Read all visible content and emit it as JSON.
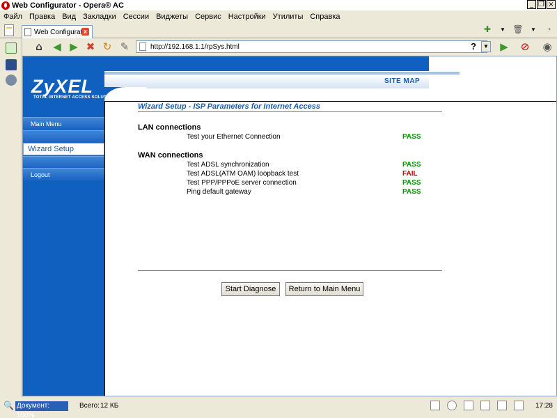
{
  "window": {
    "title": "Web Configurator - Opera® AC"
  },
  "menu": [
    "Файл",
    "Правка",
    "Вид",
    "Закладки",
    "Сессии",
    "Виджеты",
    "Сервис",
    "Настройки",
    "Утилиты",
    "Справка"
  ],
  "tab": {
    "label": "Web Configurator",
    "close": "x"
  },
  "address": {
    "url": "http://192.168.1.1/rpSys.html",
    "help": "?"
  },
  "brand": {
    "logo": "ZyXEL",
    "tagline": "TOTAL INTERNET ACCESS SOLUTION",
    "site_map": "SITE MAP",
    "color": "#1060c0"
  },
  "nav": {
    "main_menu": "Main Menu",
    "wizard_setup": "Wizard Setup",
    "logout": "Logout"
  },
  "content": {
    "title": "Wizard Setup - ISP Parameters for Internet Access",
    "lan_heading": "LAN connections",
    "lan_tests": [
      {
        "label": "Test your Ethernet Connection",
        "result": "PASS"
      }
    ],
    "wan_heading": "WAN connections",
    "wan_tests": [
      {
        "label": "Test ADSL synchronization",
        "result": "PASS"
      },
      {
        "label": "Test ADSL(ATM OAM) loopback test",
        "result": "FAIL"
      },
      {
        "label": "Test PPP/PPPoE server connection",
        "result": "PASS"
      },
      {
        "label": "Ping default gateway",
        "result": "PASS"
      }
    ],
    "start_button": "Start Diagnose",
    "return_button": "Return to Main Menu"
  },
  "status": {
    "zoom": "Документ:  100%",
    "total_label": "Всего:",
    "total_value": "12 КБ",
    "clock": "17:28"
  },
  "colors": {
    "pass": "#009900",
    "fail": "#cc0000"
  }
}
